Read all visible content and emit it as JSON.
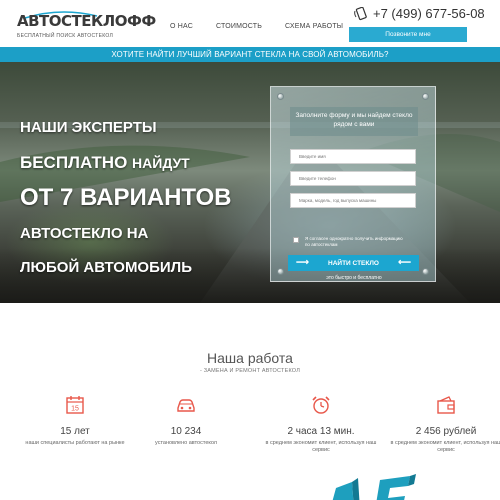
{
  "header": {
    "logo_title": "АВТОСТЕКЛОФФ",
    "logo_subtitle": "БЕСПЛАТНЫЙ ПОИСК АВТОСТЕКОЛ",
    "nav": [
      "О НАС",
      "СТОИМОСТЬ",
      "СХЕМА РАБОТЫ"
    ],
    "phone": "+7 (499) 677-56-08",
    "callback_label": "Позвоните мне"
  },
  "banner": {
    "text": "ХОТИТЕ НАЙТИ ЛУЧШИЙ ВАРИАНТ СТЕКЛА НА СВОЙ АВТОМОБИЛЬ?"
  },
  "hero": {
    "line1": "НАШИ ЭКСПЕРТЫ",
    "line2_big": "БЕСПЛАТНО",
    "line2_small": "НАЙДУТ",
    "line3": "ОТ 7 ВАРИАНТОВ",
    "line4": "АВТОСТЕКЛО НА",
    "line5": "ЛЮБОЙ АВТОМОБИЛЬ"
  },
  "form": {
    "heading": "Заполните форму и мы найдем стекло рядом с вами",
    "name_placeholder": "Введите имя",
    "phone_placeholder": "Введите телефон",
    "car_placeholder": "Марка, модель, год выпуска машины",
    "consent": "Я согласен однократно получить информацию по автостеклам",
    "submit_label": "НАЙТИ СТЕКЛО",
    "note": "это быстро и бесплатно"
  },
  "section": {
    "title": "Наша работа",
    "subtitle": "- ЗАМЕНА И РЕМОНТ АВТОСТЕКОЛ"
  },
  "stats": [
    {
      "icon": "calendar-icon",
      "value": "15 лет",
      "desc": "наши специалисты работают на рынке"
    },
    {
      "icon": "car-icon",
      "value": "10 234",
      "desc": "установлено автостекол"
    },
    {
      "icon": "alarm-clock-icon",
      "value": "2 часа 13 мин.",
      "desc": "в среднем экономит клиент, используя наш сервис"
    },
    {
      "icon": "wallet-icon",
      "value": "2 456 рублей",
      "desc": "в среднем экономит клиент, используя наш сервис"
    }
  ],
  "colors": {
    "accent": "#1ca6d0",
    "icon_red": "#e8574a"
  }
}
